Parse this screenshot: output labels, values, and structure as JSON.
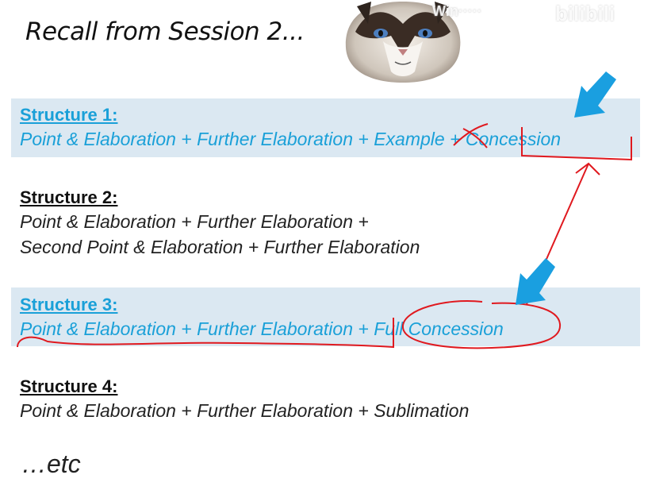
{
  "title": "Recall from Session 2...",
  "watermark": {
    "text": "Win+... bilibili",
    "left": "Win·····",
    "right": "bilibili"
  },
  "structures": [
    {
      "heading": "Structure 1:",
      "lines": [
        "Point & Elaboration + Further Elaboration + Example + Concession"
      ]
    },
    {
      "heading": "Structure 2:",
      "lines": [
        "Point & Elaboration + Further Elaboration +",
        "Second Point & Elaboration + Further Elaboration"
      ]
    },
    {
      "heading": "Structure 3:",
      "lines": [
        "Point & Elaboration + Further Elaboration + Full Concession"
      ]
    },
    {
      "heading": "Structure 4:",
      "lines": [
        "Point & Elaboration + Further Elaboration + Sublimation"
      ]
    }
  ],
  "etc": "…etc",
  "colors": {
    "highlight_text": "#1aa0d8",
    "highlight_band": "#dbe8f2",
    "annotation_red": "#e0191f",
    "arrow_blue": "#1a9fe0"
  },
  "icons": [
    "cat-photo",
    "blue-arrow-icon",
    "red-annotation-marks"
  ]
}
